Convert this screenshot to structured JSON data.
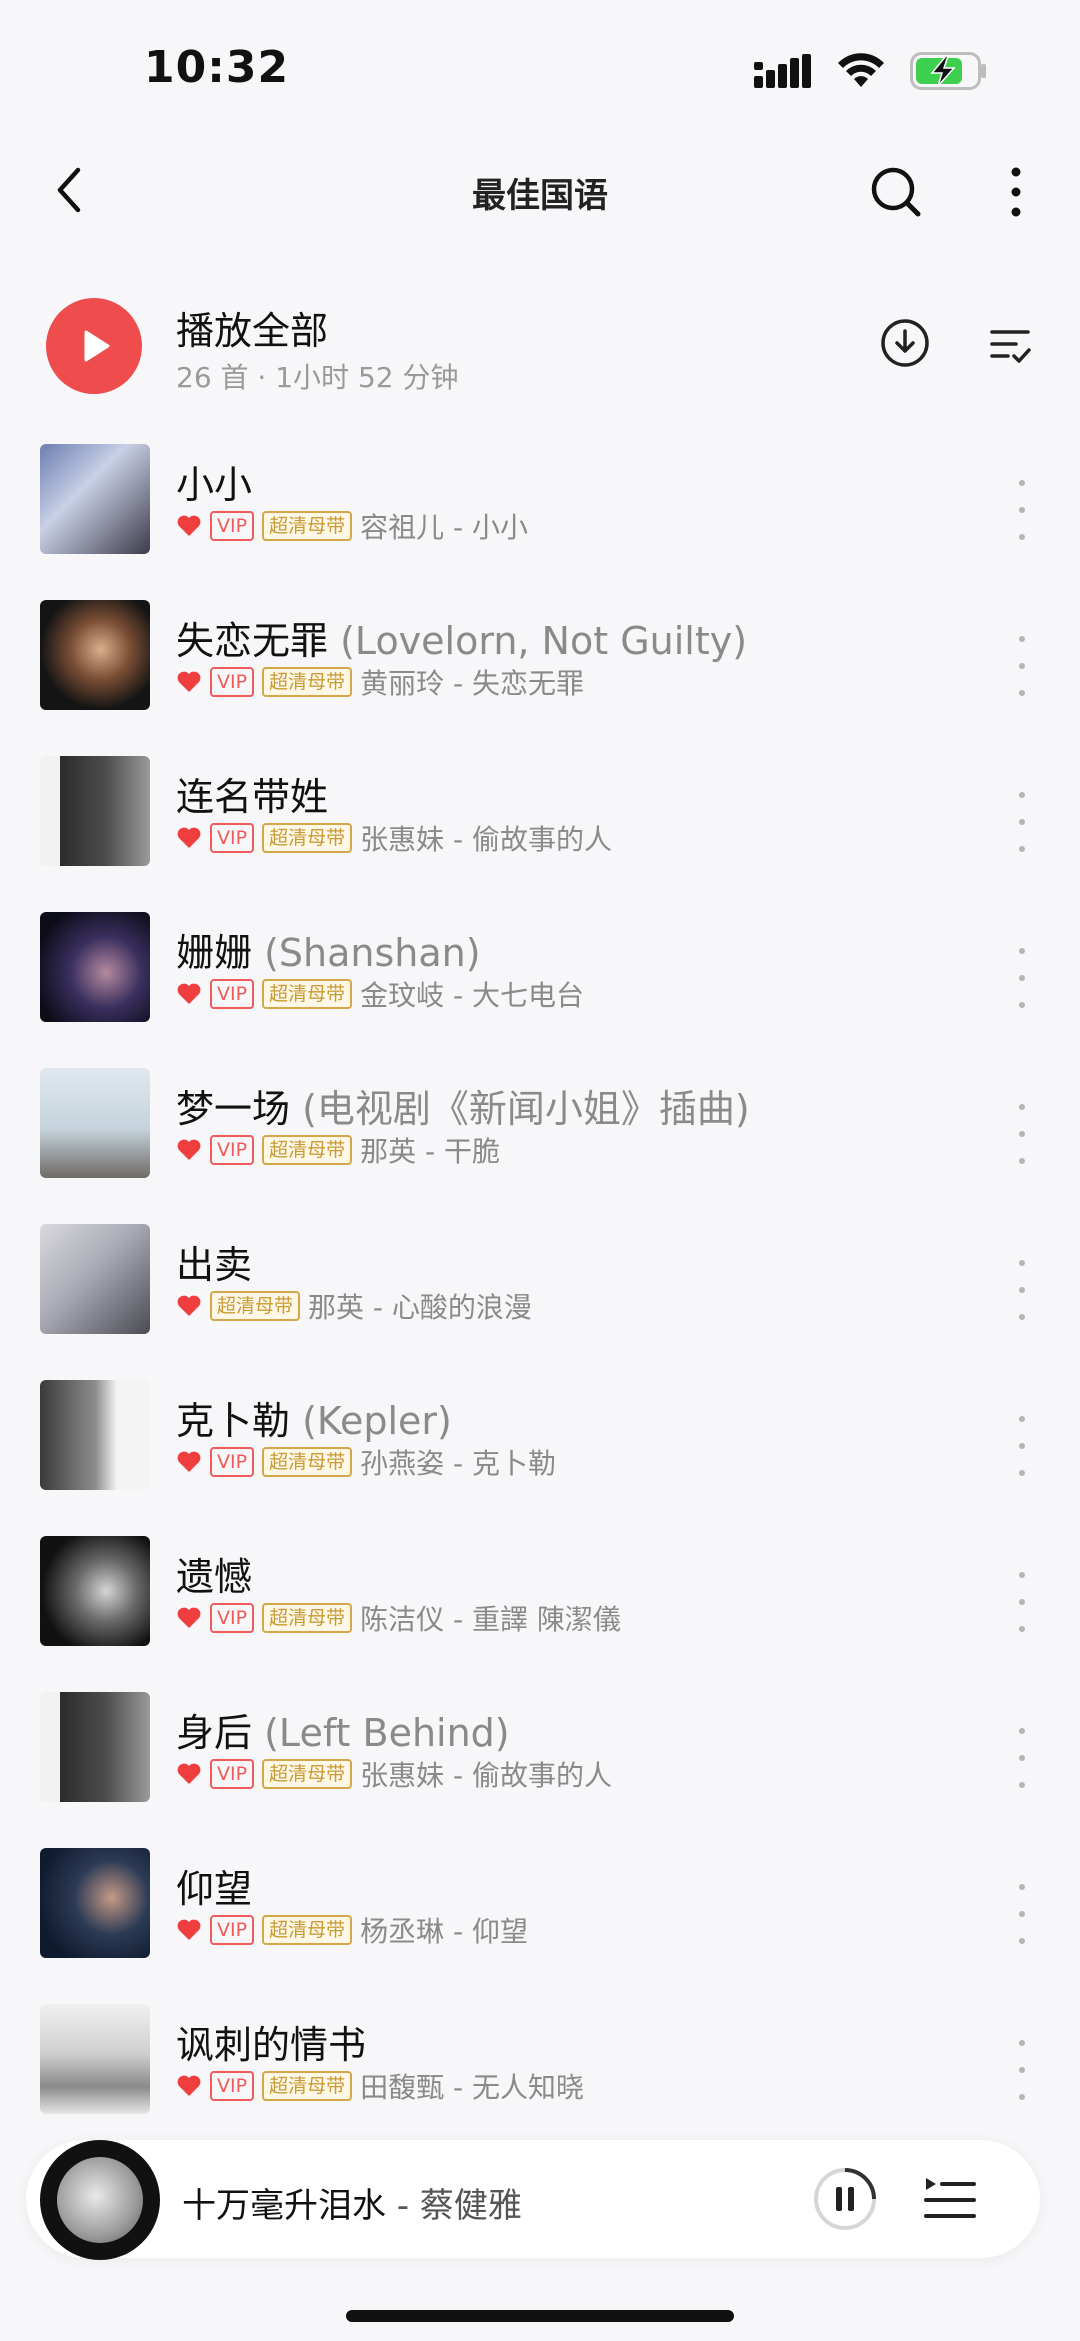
{
  "status": {
    "time": "10:32"
  },
  "nav": {
    "title": "最佳国语"
  },
  "play_all": {
    "label": "播放全部",
    "meta": "26 首 · 1小时 52 分钟"
  },
  "tags": {
    "vip": "VIP",
    "hq": "超清母带"
  },
  "songs": [
    {
      "title": "小小",
      "alt": "",
      "artist_album": "容祖儿 - 小小",
      "vip": true
    },
    {
      "title": "失恋无罪",
      "alt": "(Lovelorn, Not Guilty)",
      "artist_album": "黄丽玲 - 失恋无罪",
      "vip": true
    },
    {
      "title": "连名带姓",
      "alt": "",
      "artist_album": "张惠妹 - 偷故事的人",
      "vip": true
    },
    {
      "title": "姗姗",
      "alt": "(Shanshan)",
      "artist_album": "金玟岐 - 大七电台",
      "vip": true
    },
    {
      "title": "梦一场",
      "alt": "(电视剧《新闻小姐》插曲)",
      "artist_album": "那英 - 干脆",
      "vip": true
    },
    {
      "title": "出卖",
      "alt": "",
      "artist_album": "那英 - 心酸的浪漫",
      "vip": false
    },
    {
      "title": "克卜勒",
      "alt": "(Kepler)",
      "artist_album": "孙燕姿 - 克卜勒",
      "vip": true
    },
    {
      "title": "遗憾",
      "alt": "",
      "artist_album": "陈洁仪 - 重譯 陳潔儀",
      "vip": true
    },
    {
      "title": "身后",
      "alt": "(Left Behind)",
      "artist_album": "张惠妹 - 偷故事的人",
      "vip": true
    },
    {
      "title": "仰望",
      "alt": "",
      "artist_album": "杨丞琳 - 仰望",
      "vip": true
    },
    {
      "title": "讽刺的情书",
      "alt": "",
      "artist_album": "田馥甄 - 无人知晓",
      "vip": true
    }
  ],
  "player": {
    "song": "十万毫升泪水",
    "artist": " - 蔡健雅"
  },
  "colors": {
    "accent": "#ef4d4d",
    "hq_gold": "#c99a33",
    "muted": "#8a8a8a"
  }
}
